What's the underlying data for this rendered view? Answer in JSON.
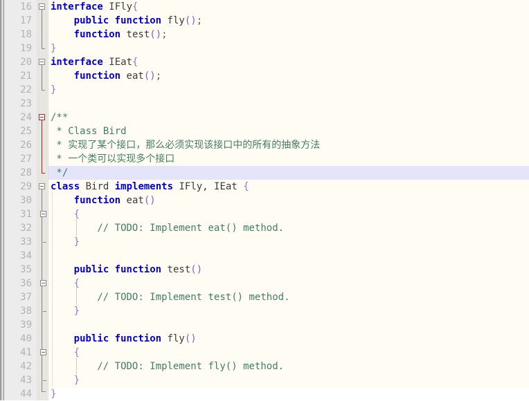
{
  "editor": {
    "name": "code-editor",
    "language": "php",
    "first_visible_line": 16,
    "last_visible_line": 44,
    "line_height_px": 20,
    "current_line": 28,
    "colors": {
      "code_background": "#fffdf3",
      "page_background": "#ffffff",
      "gutter_background": "#ececec",
      "fold_strip_background": "#f0efe9",
      "line_number": "#b2b2b2",
      "current_line_highlight": "#e4e4fb",
      "keyword": "#0000cc",
      "identifier": "#3a3a3a",
      "comment": "#3f7f5f",
      "brace": "#8e7cc3",
      "paren": "#7b5fd0",
      "fold_marker": "#8c8c8c",
      "fold_marker_comment": "#9e2b2b"
    }
  },
  "lines": [
    {
      "number": "16",
      "indent": 0,
      "fold": "open",
      "tokens": [
        {
          "t": "kw",
          "s": "interface"
        },
        {
          "t": "id",
          "s": " IFly"
        },
        {
          "t": "brace",
          "s": "{"
        }
      ]
    },
    {
      "number": "17",
      "indent": 1,
      "fold": "bar",
      "tokens": [
        {
          "t": "kw",
          "s": "public function"
        },
        {
          "t": "id",
          "s": " fly"
        },
        {
          "t": "paren",
          "s": "()"
        },
        {
          "t": "punc",
          "s": ";"
        }
      ]
    },
    {
      "number": "18",
      "indent": 1,
      "fold": "bar",
      "tokens": [
        {
          "t": "kw",
          "s": "function"
        },
        {
          "t": "id",
          "s": " test"
        },
        {
          "t": "paren",
          "s": "()"
        },
        {
          "t": "punc",
          "s": ";"
        }
      ]
    },
    {
      "number": "19",
      "indent": 0,
      "fold": "end",
      "tokens": [
        {
          "t": "brace",
          "s": "}"
        }
      ]
    },
    {
      "number": "20",
      "indent": 0,
      "fold": "open",
      "tokens": [
        {
          "t": "kw",
          "s": "interface"
        },
        {
          "t": "id",
          "s": " IEat"
        },
        {
          "t": "brace",
          "s": "{"
        }
      ]
    },
    {
      "number": "21",
      "indent": 1,
      "fold": "bar",
      "tokens": [
        {
          "t": "kw",
          "s": "function"
        },
        {
          "t": "id",
          "s": " eat"
        },
        {
          "t": "paren",
          "s": "()"
        },
        {
          "t": "punc",
          "s": ";"
        }
      ]
    },
    {
      "number": "22",
      "indent": 0,
      "fold": "end",
      "tokens": [
        {
          "t": "brace",
          "s": "}"
        }
      ]
    },
    {
      "number": "23",
      "indent": 0,
      "fold": "none",
      "tokens": []
    },
    {
      "number": "24",
      "indent": 0,
      "fold": "open-red",
      "tokens": [
        {
          "t": "comment",
          "s": "/**"
        }
      ]
    },
    {
      "number": "25",
      "indent": 0,
      "fold": "bar-red",
      "tokens": [
        {
          "t": "comment",
          "s": " * Class Bird"
        }
      ]
    },
    {
      "number": "26",
      "indent": 0,
      "fold": "bar-red",
      "tokens": [
        {
          "t": "comment",
          "s": " * "
        },
        {
          "t": "cjk",
          "s": "实现了某个接口，那么必须实现该接口中的所有的抽象方法"
        }
      ]
    },
    {
      "number": "27",
      "indent": 0,
      "fold": "bar-red",
      "tokens": [
        {
          "t": "comment",
          "s": " * "
        },
        {
          "t": "cjk",
          "s": "一个类可以实现多个接口"
        }
      ]
    },
    {
      "number": "28",
      "indent": 0,
      "fold": "end-red",
      "tokens": [
        {
          "t": "comment",
          "s": " */"
        }
      ]
    },
    {
      "number": "29",
      "indent": 0,
      "fold": "open",
      "tokens": [
        {
          "t": "kw",
          "s": "class"
        },
        {
          "t": "id",
          "s": " Bird "
        },
        {
          "t": "kw",
          "s": "implements"
        },
        {
          "t": "id",
          "s": " IFly, IEat "
        },
        {
          "t": "brace",
          "s": "{"
        }
      ]
    },
    {
      "number": "30",
      "indent": 1,
      "fold": "bar",
      "tokens": [
        {
          "t": "kw",
          "s": "function"
        },
        {
          "t": "id",
          "s": " eat"
        },
        {
          "t": "paren",
          "s": "()"
        }
      ]
    },
    {
      "number": "31",
      "indent": 1,
      "fold": "bar-open",
      "tokens": [
        {
          "t": "brace",
          "s": "{"
        }
      ]
    },
    {
      "number": "32",
      "indent": 2,
      "fold": "bar",
      "tokens": [
        {
          "t": "comment",
          "s": "// TODO: Implement eat() method."
        }
      ]
    },
    {
      "number": "33",
      "indent": 1,
      "fold": "bar-end",
      "tokens": [
        {
          "t": "brace",
          "s": "}"
        }
      ]
    },
    {
      "number": "34",
      "indent": 0,
      "fold": "bar",
      "tokens": []
    },
    {
      "number": "35",
      "indent": 1,
      "fold": "bar",
      "tokens": [
        {
          "t": "kw",
          "s": "public function"
        },
        {
          "t": "id",
          "s": " test"
        },
        {
          "t": "paren",
          "s": "()"
        }
      ]
    },
    {
      "number": "36",
      "indent": 1,
      "fold": "bar-open",
      "tokens": [
        {
          "t": "brace",
          "s": "{"
        }
      ]
    },
    {
      "number": "37",
      "indent": 2,
      "fold": "bar",
      "tokens": [
        {
          "t": "comment",
          "s": "// TODO: Implement test() method."
        }
      ]
    },
    {
      "number": "38",
      "indent": 1,
      "fold": "bar-end",
      "tokens": [
        {
          "t": "brace",
          "s": "}"
        }
      ]
    },
    {
      "number": "39",
      "indent": 0,
      "fold": "bar",
      "tokens": []
    },
    {
      "number": "40",
      "indent": 1,
      "fold": "bar",
      "tokens": [
        {
          "t": "kw",
          "s": "public function"
        },
        {
          "t": "id",
          "s": " fly"
        },
        {
          "t": "paren",
          "s": "()"
        }
      ]
    },
    {
      "number": "41",
      "indent": 1,
      "fold": "bar-open",
      "tokens": [
        {
          "t": "brace",
          "s": "{"
        }
      ]
    },
    {
      "number": "42",
      "indent": 2,
      "fold": "bar",
      "tokens": [
        {
          "t": "comment",
          "s": "// TODO: Implement fly() method."
        }
      ]
    },
    {
      "number": "43",
      "indent": 1,
      "fold": "bar-end",
      "tokens": [
        {
          "t": "brace",
          "s": "}"
        }
      ]
    },
    {
      "number": "44",
      "indent": 0,
      "fold": "corner",
      "tokens": [
        {
          "t": "brace",
          "s": "}"
        }
      ]
    }
  ]
}
